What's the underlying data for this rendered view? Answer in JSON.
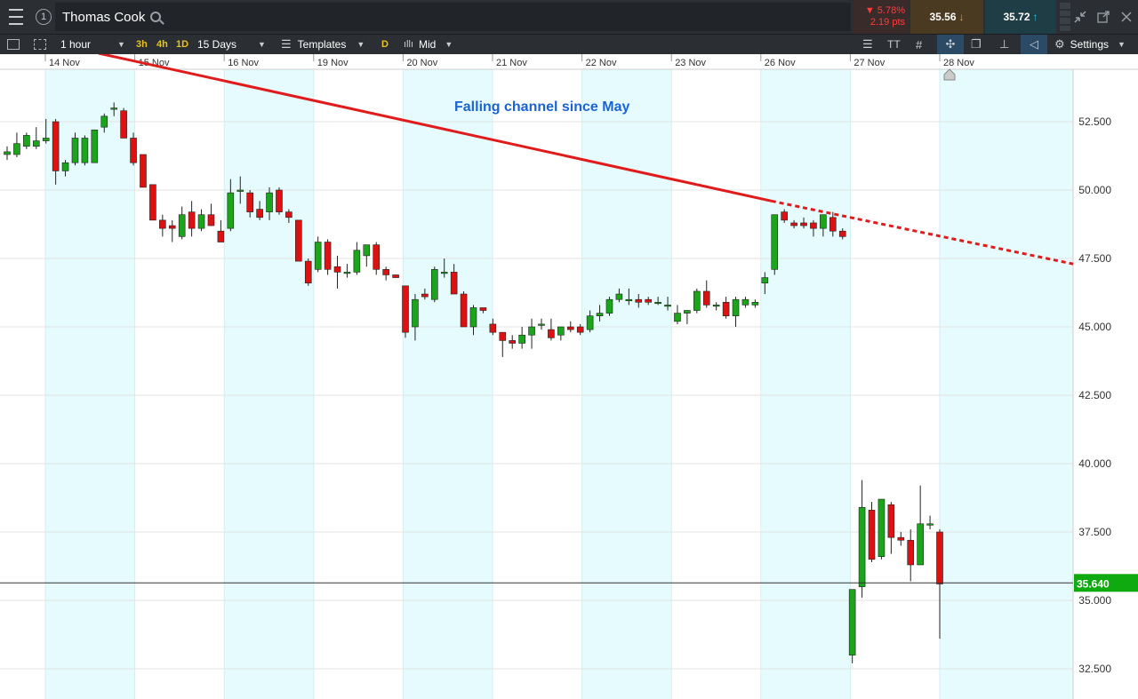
{
  "topbar": {
    "instrument_name": "Thomas Cook",
    "change_pct": "▼ 5.78%",
    "change_pts": "2.19 pts",
    "sell_price": "35.56",
    "buy_price": "35.72",
    "circle_label": "1"
  },
  "toolbar": {
    "interval": "1 hour",
    "quick_3h": "3h",
    "quick_4h": "4h",
    "quick_1d": "1D",
    "range": "15 Days",
    "templates": "Templates",
    "d_label": "D",
    "price_type": "Mid",
    "text_tool": "TT",
    "settings": "Settings"
  },
  "colors": {
    "up": "#1aa51a",
    "down": "#dd1111",
    "trend": "#e01b1b",
    "band": "#e6fbfd",
    "price_tag": "#0faa0f",
    "annotation": "#1a64d4"
  },
  "annotation_text": "Falling channel since May",
  "chart_data": {
    "type": "candlestick",
    "ylim": [
      31.7,
      55.0
    ],
    "yticks": [
      32.5,
      35.0,
      37.5,
      40.0,
      42.5,
      45.0,
      47.5,
      50.0,
      52.5
    ],
    "ytick_labels": [
      "32.500",
      "35.000",
      "37.500",
      "40.000",
      "42.500",
      "45.000",
      "47.500",
      "50.000",
      "52.500"
    ],
    "day_labels": [
      "14 Nov",
      "15 Nov",
      "16 Nov",
      "19 Nov",
      "20 Nov",
      "21 Nov",
      "22 Nov",
      "23 Nov",
      "26 Nov",
      "27 Nov",
      "28 Nov"
    ],
    "shaded_days": [
      "14 Nov",
      "16 Nov",
      "20 Nov",
      "22 Nov",
      "26 Nov",
      "28 Nov"
    ],
    "current_price": 35.64,
    "current_price_label": "35.640",
    "candles": [
      {
        "o": 51.3,
        "h": 51.6,
        "l": 51.1,
        "c": 51.4
      },
      {
        "o": 51.3,
        "h": 52.1,
        "l": 51.2,
        "c": 51.7
      },
      {
        "o": 51.6,
        "h": 52.1,
        "l": 51.5,
        "c": 52.0
      },
      {
        "o": 51.6,
        "h": 52.3,
        "l": 51.5,
        "c": 51.8
      },
      {
        "o": 51.8,
        "h": 52.6,
        "l": 51.7,
        "c": 51.9
      },
      {
        "o": 52.5,
        "h": 52.6,
        "l": 50.2,
        "c": 50.7
      },
      {
        "o": 50.7,
        "h": 51.1,
        "l": 50.5,
        "c": 51.0
      },
      {
        "o": 51.0,
        "h": 52.1,
        "l": 50.9,
        "c": 51.9
      },
      {
        "o": 51.0,
        "h": 52.0,
        "l": 50.9,
        "c": 51.9
      },
      {
        "o": 51.0,
        "h": 52.2,
        "l": 51.0,
        "c": 52.2
      },
      {
        "o": 52.3,
        "h": 52.8,
        "l": 52.1,
        "c": 52.7
      },
      {
        "o": 53.0,
        "h": 53.2,
        "l": 52.7,
        "c": 53.0
      },
      {
        "o": 52.9,
        "h": 53.0,
        "l": 51.9,
        "c": 51.9
      },
      {
        "o": 51.9,
        "h": 52.1,
        "l": 50.9,
        "c": 51.0
      },
      {
        "o": 51.3,
        "h": 51.3,
        "l": 50.1,
        "c": 50.1
      },
      {
        "o": 50.2,
        "h": 50.2,
        "l": 48.9,
        "c": 48.9
      },
      {
        "o": 48.9,
        "h": 49.1,
        "l": 48.3,
        "c": 48.6
      },
      {
        "o": 48.7,
        "h": 48.9,
        "l": 48.1,
        "c": 48.6
      },
      {
        "o": 48.3,
        "h": 49.4,
        "l": 48.2,
        "c": 49.1
      },
      {
        "o": 49.2,
        "h": 49.6,
        "l": 48.3,
        "c": 48.6
      },
      {
        "o": 48.6,
        "h": 49.3,
        "l": 48.5,
        "c": 49.1
      },
      {
        "o": 49.1,
        "h": 49.5,
        "l": 48.7,
        "c": 48.7
      },
      {
        "o": 48.5,
        "h": 48.9,
        "l": 48.1,
        "c": 48.1
      },
      {
        "o": 48.6,
        "h": 50.4,
        "l": 48.5,
        "c": 49.9
      },
      {
        "o": 50.0,
        "h": 50.5,
        "l": 49.5,
        "c": 50.0
      },
      {
        "o": 49.9,
        "h": 50.0,
        "l": 49.0,
        "c": 49.2
      },
      {
        "o": 49.3,
        "h": 49.6,
        "l": 48.9,
        "c": 49.0
      },
      {
        "o": 49.2,
        "h": 50.1,
        "l": 48.9,
        "c": 49.9
      },
      {
        "o": 50.0,
        "h": 50.1,
        "l": 49.1,
        "c": 49.2
      },
      {
        "o": 49.2,
        "h": 49.3,
        "l": 48.8,
        "c": 49.0
      },
      {
        "o": 48.9,
        "h": 48.9,
        "l": 47.4,
        "c": 47.4
      },
      {
        "o": 47.4,
        "h": 47.5,
        "l": 46.5,
        "c": 46.6
      },
      {
        "o": 47.1,
        "h": 48.3,
        "l": 47.0,
        "c": 48.1
      },
      {
        "o": 48.1,
        "h": 48.2,
        "l": 46.9,
        "c": 47.1
      },
      {
        "o": 47.2,
        "h": 47.6,
        "l": 46.4,
        "c": 47.0
      },
      {
        "o": 47.0,
        "h": 47.3,
        "l": 46.8,
        "c": 47.0
      },
      {
        "o": 47.0,
        "h": 48.1,
        "l": 46.9,
        "c": 47.8
      },
      {
        "o": 47.6,
        "h": 48.0,
        "l": 47.2,
        "c": 48.0
      },
      {
        "o": 48.0,
        "h": 48.1,
        "l": 46.9,
        "c": 47.1
      },
      {
        "o": 47.1,
        "h": 47.2,
        "l": 46.7,
        "c": 46.9
      },
      {
        "o": 46.9,
        "h": 46.9,
        "l": 46.8,
        "c": 46.8
      },
      {
        "o": 46.5,
        "h": 46.5,
        "l": 44.6,
        "c": 44.8
      },
      {
        "o": 45.0,
        "h": 46.2,
        "l": 44.5,
        "c": 46.0
      },
      {
        "o": 46.2,
        "h": 46.4,
        "l": 46.0,
        "c": 46.1
      },
      {
        "o": 46.0,
        "h": 47.2,
        "l": 45.9,
        "c": 47.1
      },
      {
        "o": 47.0,
        "h": 47.5,
        "l": 46.8,
        "c": 47.0
      },
      {
        "o": 47.0,
        "h": 47.3,
        "l": 46.2,
        "c": 46.2
      },
      {
        "o": 46.2,
        "h": 46.3,
        "l": 45.0,
        "c": 45.0
      },
      {
        "o": 45.0,
        "h": 45.8,
        "l": 44.7,
        "c": 45.7
      },
      {
        "o": 45.7,
        "h": 45.7,
        "l": 45.5,
        "c": 45.6
      },
      {
        "o": 45.1,
        "h": 45.3,
        "l": 44.7,
        "c": 44.8
      },
      {
        "o": 44.8,
        "h": 44.8,
        "l": 43.9,
        "c": 44.5
      },
      {
        "o": 44.5,
        "h": 44.7,
        "l": 44.2,
        "c": 44.4
      },
      {
        "o": 44.4,
        "h": 45.0,
        "l": 44.2,
        "c": 44.7
      },
      {
        "o": 44.7,
        "h": 45.3,
        "l": 44.2,
        "c": 45.0
      },
      {
        "o": 45.1,
        "h": 45.3,
        "l": 44.9,
        "c": 45.1
      },
      {
        "o": 44.9,
        "h": 45.3,
        "l": 44.5,
        "c": 44.6
      },
      {
        "o": 44.7,
        "h": 45.0,
        "l": 44.5,
        "c": 45.0
      },
      {
        "o": 45.0,
        "h": 45.2,
        "l": 44.8,
        "c": 44.9
      },
      {
        "o": 45.0,
        "h": 45.1,
        "l": 44.7,
        "c": 44.8
      },
      {
        "o": 44.9,
        "h": 45.6,
        "l": 44.8,
        "c": 45.4
      },
      {
        "o": 45.4,
        "h": 45.8,
        "l": 45.2,
        "c": 45.5
      },
      {
        "o": 45.5,
        "h": 46.1,
        "l": 45.4,
        "c": 46.0
      },
      {
        "o": 46.0,
        "h": 46.4,
        "l": 45.9,
        "c": 46.2
      },
      {
        "o": 46.0,
        "h": 46.4,
        "l": 45.8,
        "c": 46.0
      },
      {
        "o": 46.0,
        "h": 46.2,
        "l": 45.7,
        "c": 45.9
      },
      {
        "o": 46.0,
        "h": 46.1,
        "l": 45.8,
        "c": 45.9
      },
      {
        "o": 45.9,
        "h": 46.1,
        "l": 45.8,
        "c": 45.9
      },
      {
        "o": 45.8,
        "h": 46.1,
        "l": 45.6,
        "c": 45.8
      },
      {
        "o": 45.2,
        "h": 45.8,
        "l": 45.1,
        "c": 45.5
      },
      {
        "o": 45.5,
        "h": 45.6,
        "l": 45.1,
        "c": 45.6
      },
      {
        "o": 45.6,
        "h": 46.4,
        "l": 45.5,
        "c": 46.3
      },
      {
        "o": 46.3,
        "h": 46.7,
        "l": 45.7,
        "c": 45.8
      },
      {
        "o": 45.8,
        "h": 45.9,
        "l": 45.6,
        "c": 45.8
      },
      {
        "o": 45.9,
        "h": 46.1,
        "l": 45.3,
        "c": 45.4
      },
      {
        "o": 45.4,
        "h": 46.1,
        "l": 45.0,
        "c": 46.0
      },
      {
        "o": 45.8,
        "h": 46.1,
        "l": 45.7,
        "c": 46.0
      },
      {
        "o": 45.8,
        "h": 46.0,
        "l": 45.7,
        "c": 45.9
      },
      {
        "o": 46.6,
        "h": 47.0,
        "l": 46.2,
        "c": 46.8
      },
      {
        "o": 47.1,
        "h": 48.3,
        "l": 46.9,
        "c": 49.1
      },
      {
        "o": 49.2,
        "h": 49.3,
        "l": 48.8,
        "c": 48.9
      },
      {
        "o": 48.8,
        "h": 48.9,
        "l": 48.6,
        "c": 48.7
      },
      {
        "o": 48.8,
        "h": 49.0,
        "l": 48.6,
        "c": 48.7
      },
      {
        "o": 48.8,
        "h": 48.9,
        "l": 48.3,
        "c": 48.6
      },
      {
        "o": 48.6,
        "h": 49.1,
        "l": 48.3,
        "c": 49.1
      },
      {
        "o": 49.0,
        "h": 49.2,
        "l": 48.3,
        "c": 48.5
      },
      {
        "o": 48.5,
        "h": 48.6,
        "l": 48.2,
        "c": 48.3
      },
      {
        "o": 33.0,
        "h": 35.3,
        "l": 32.7,
        "c": 35.4
      },
      {
        "o": 35.5,
        "h": 39.4,
        "l": 35.1,
        "c": 38.4
      },
      {
        "o": 38.3,
        "h": 38.6,
        "l": 36.4,
        "c": 36.5
      },
      {
        "o": 36.6,
        "h": 38.7,
        "l": 36.5,
        "c": 38.7
      },
      {
        "o": 38.5,
        "h": 38.6,
        "l": 36.7,
        "c": 37.3
      },
      {
        "o": 37.3,
        "h": 37.5,
        "l": 37.0,
        "c": 37.2
      },
      {
        "o": 37.2,
        "h": 37.6,
        "l": 35.7,
        "c": 36.3
      },
      {
        "o": 36.3,
        "h": 39.2,
        "l": 36.3,
        "c": 37.8
      },
      {
        "o": 37.8,
        "h": 38.1,
        "l": 37.6,
        "c": 37.8
      },
      {
        "o": 37.5,
        "h": 37.6,
        "l": 33.6,
        "c": 35.6
      }
    ],
    "trendline": {
      "start": {
        "day": "14 Nov",
        "value": 55.0
      },
      "end_solid": {
        "day": "26 Nov",
        "value": 49.6
      },
      "end_dashed": {
        "day": "28 Nov",
        "value": 47.3
      }
    }
  }
}
